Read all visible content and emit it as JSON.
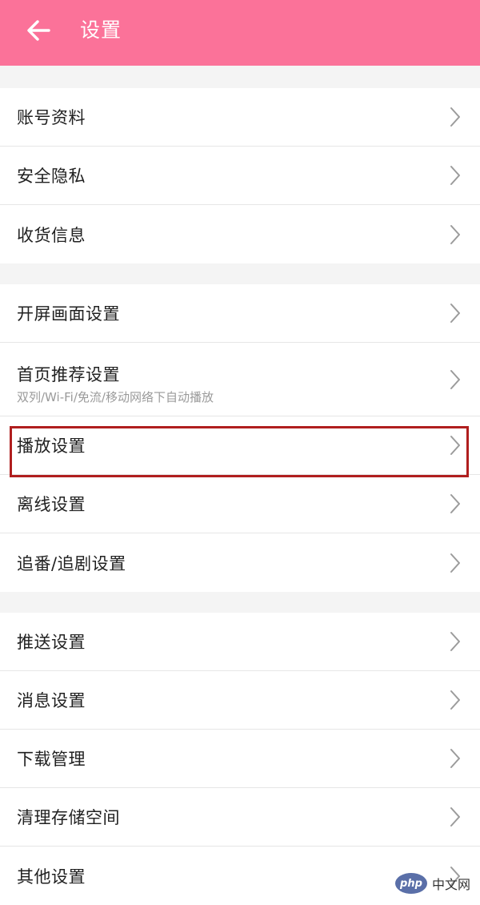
{
  "header": {
    "title": "设置",
    "background": "#fb7299"
  },
  "groups": [
    {
      "items": [
        {
          "label": "账号资料"
        },
        {
          "label": "安全隐私"
        },
        {
          "label": "收货信息"
        }
      ]
    },
    {
      "items": [
        {
          "label": "开屏画面设置"
        },
        {
          "label": "首页推荐设置",
          "subtitle": "双列/Wi-Fi/免流/移动网络下自动播放"
        },
        {
          "label": "播放设置",
          "highlighted": true
        },
        {
          "label": "离线设置"
        },
        {
          "label": "追番/追剧设置"
        }
      ]
    },
    {
      "items": [
        {
          "label": "推送设置"
        },
        {
          "label": "消息设置"
        },
        {
          "label": "下载管理"
        },
        {
          "label": "清理存储空间"
        },
        {
          "label": "其他设置"
        }
      ]
    }
  ],
  "highlight_color": "#b01e1e",
  "icons": {
    "back": "arrow-left-icon",
    "row_chevron": "chevron-right-icon"
  },
  "watermark": {
    "logo_text": "php",
    "text": "中文网"
  }
}
